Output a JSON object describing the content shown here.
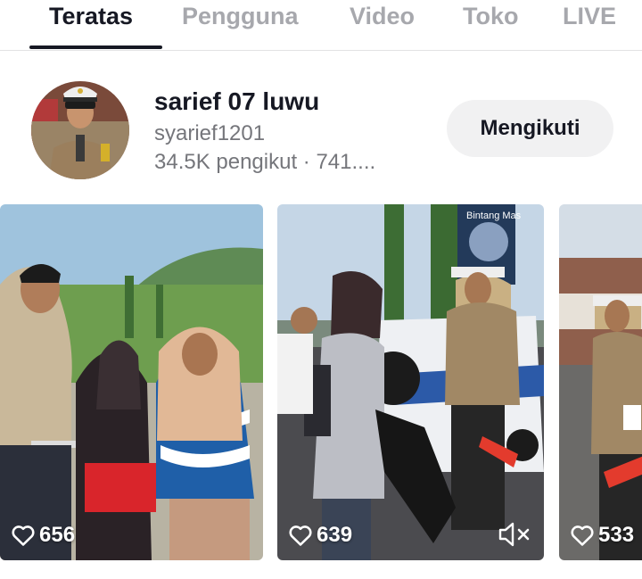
{
  "tabs": [
    {
      "label": "Teratas",
      "active": true
    },
    {
      "label": "Pengguna",
      "active": false
    },
    {
      "label": "Video",
      "active": false
    },
    {
      "label": "Toko",
      "active": false
    },
    {
      "label": "LIVE",
      "active": false
    }
  ],
  "user": {
    "display_name": "sarief 07 luwu",
    "username": "syarief1201",
    "stats": "34.5K pengikut · 741....",
    "follow_label": "Mengikuti"
  },
  "videos": [
    {
      "likes": "656",
      "muted": false,
      "sign_text": ""
    },
    {
      "likes": "639",
      "muted": true,
      "sign_text": "Bintang Mas"
    },
    {
      "likes": "533",
      "muted": false,
      "sign_text": ""
    }
  ],
  "colors": {
    "text_primary": "#161823",
    "text_secondary": "#75767b",
    "tab_inactive": "#a7a8ad",
    "button_bg": "#f1f1f2",
    "divider": "#e3e3e4"
  },
  "icons": {
    "like": "heart-outline-icon",
    "sound": "speaker-muted-icon"
  }
}
